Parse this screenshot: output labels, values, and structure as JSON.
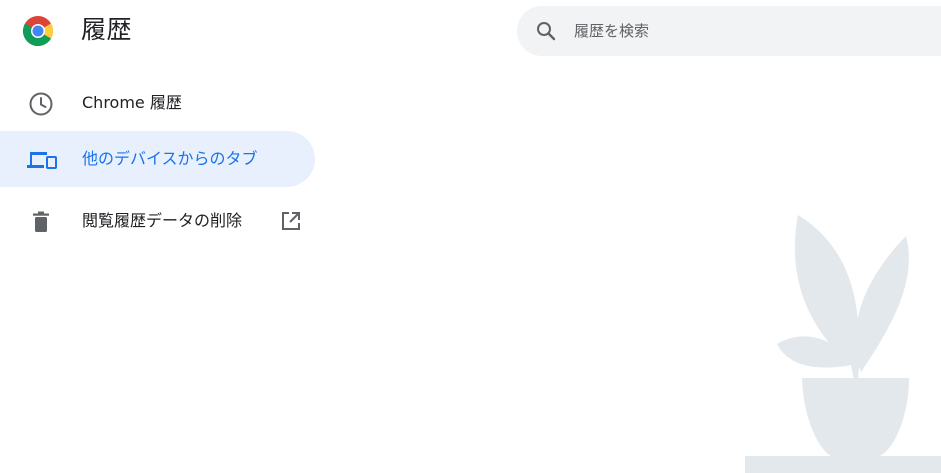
{
  "header": {
    "title": "履歴",
    "logo_icon": "chrome-logo-icon"
  },
  "search": {
    "placeholder": "履歴を検索",
    "icon": "search-icon"
  },
  "sidebar": {
    "items": [
      {
        "label": "Chrome 履歴",
        "icon": "clock-icon",
        "selected": false
      },
      {
        "label": "他のデバイスからのタブ",
        "icon": "devices-icon",
        "selected": true
      },
      {
        "label": "閲覧履歴データの削除",
        "icon": "trash-icon",
        "selected": false,
        "trailing_icon": "open-in-new-icon"
      }
    ]
  },
  "colors": {
    "accent": "#1a73e8",
    "selected_background": "#e8f0fe",
    "search_background": "#f1f3f4",
    "text_primary": "#202124",
    "text_secondary": "#5f6368",
    "illustration": "#e3e8ed"
  }
}
